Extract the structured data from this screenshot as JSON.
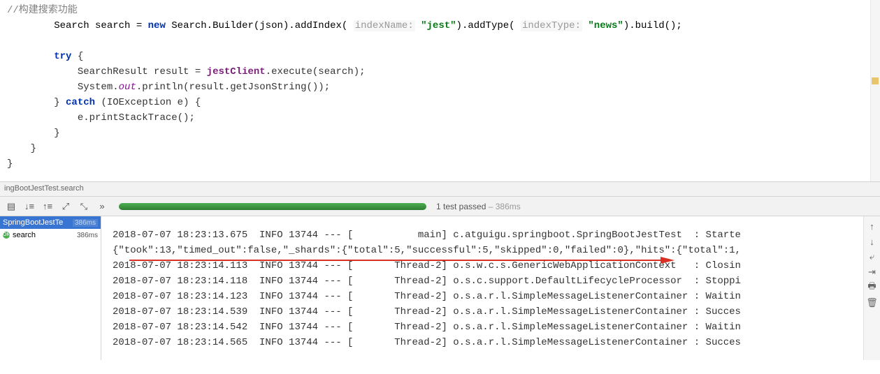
{
  "code": {
    "comment": "//构建搜索功能",
    "line1_a": "Search search = ",
    "line1_new": "new",
    "line1_b": " Search.Builder(json).addIndex( ",
    "line1_hint1": "indexName:",
    "line1_str1": "\"jest\"",
    "line1_c": ").addType( ",
    "line1_hint2": "indexType:",
    "line1_str2": "\"news\"",
    "line1_d": ").build();",
    "try_kw": "try",
    "try_open": " {",
    "line_tr1_a": "SearchResult result = ",
    "line_tr1_m": "jestClient",
    "line_tr1_b": ".execute(search);",
    "line_tr2_a": "System.",
    "line_tr2_out": "out",
    "line_tr2_b": ".println(result.getJsonString());",
    "catch_a": "} ",
    "catch_kw": "catch",
    "catch_b": " (IOException e) {",
    "line_c1": "e.printStackTrace();",
    "close1": "}",
    "close2": "}",
    "close3": "}"
  },
  "breadcrumb": "ingBootJestTest.search",
  "toolbar": {
    "status_main": "1 test passed",
    "status_time": " – 386ms"
  },
  "tree": {
    "class_name": "SpringBootJestTe",
    "class_time": "386ms",
    "method_name": "search",
    "method_time": "386ms"
  },
  "console_lines": [
    "2018-07-07 18:23:13.675  INFO 13744 --- [           main] c.atguigu.springboot.SpringBootJestTest  : Starte",
    "{\"took\":13,\"timed_out\":false,\"_shards\":{\"total\":5,\"successful\":5,\"skipped\":0,\"failed\":0},\"hits\":{\"total\":1,",
    "2018-07-07 18:23:14.113  INFO 13744 --- [       Thread-2] o.s.w.c.s.GenericWebApplicationContext   : Closin",
    "2018-07-07 18:23:14.118  INFO 13744 --- [       Thread-2] o.s.c.support.DefaultLifecycleProcessor  : Stoppi",
    "2018-07-07 18:23:14.123  INFO 13744 --- [       Thread-2] o.s.a.r.l.SimpleMessageListenerContainer : Waitin",
    "2018-07-07 18:23:14.539  INFO 13744 --- [       Thread-2] o.s.a.r.l.SimpleMessageListenerContainer : Succes",
    "2018-07-07 18:23:14.542  INFO 13744 --- [       Thread-2] o.s.a.r.l.SimpleMessageListenerContainer : Waitin",
    "2018-07-07 18:23:14.565  INFO 13744 --- [       Thread-2] o.s.a.r.l.SimpleMessageListenerContainer : Succes"
  ]
}
